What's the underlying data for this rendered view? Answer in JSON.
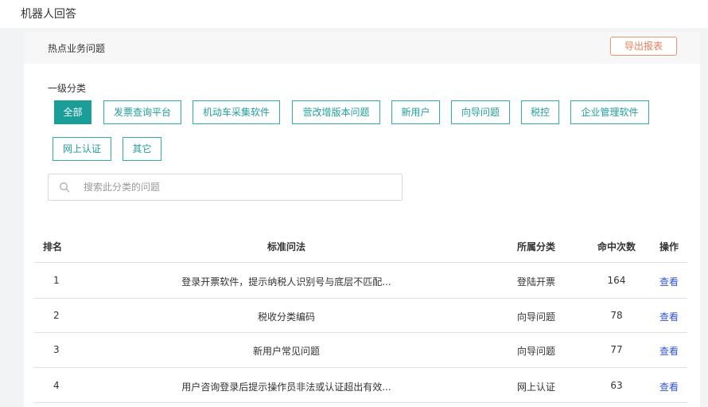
{
  "page": {
    "title": "机器人回答"
  },
  "panel": {
    "title": "热点业务问题",
    "export_label": "导出报表",
    "category_label": "一级分类",
    "categories": [
      {
        "label": "全部",
        "active": true
      },
      {
        "label": "发票查询平台",
        "active": false
      },
      {
        "label": "机动车采集软件",
        "active": false
      },
      {
        "label": "营改增版本问题",
        "active": false
      },
      {
        "label": "新用户",
        "active": false
      },
      {
        "label": "向导问题",
        "active": false
      },
      {
        "label": "税控",
        "active": false
      },
      {
        "label": "企业管理软件",
        "active": false
      },
      {
        "label": "网上认证",
        "active": false
      },
      {
        "label": "其它",
        "active": false
      }
    ],
    "search": {
      "placeholder": "搜索此分类的问题",
      "value": "",
      "icon": "search-icon"
    }
  },
  "table": {
    "headers": {
      "rank": "排名",
      "question": "标准问法",
      "category": "所属分类",
      "hits": "命中次数",
      "action": "操作"
    },
    "rows": [
      {
        "rank": "1",
        "question": "登录开票软件，提示纳税人识别号与底层不匹配...",
        "category": "登陆开票",
        "hits": "164",
        "action": "查看"
      },
      {
        "rank": "2",
        "question": "税收分类编码",
        "category": "向导问题",
        "hits": "78",
        "action": "查看"
      },
      {
        "rank": "3",
        "question": "新用户常见问题",
        "category": "向导问题",
        "hits": "77",
        "action": "查看"
      },
      {
        "rank": "4",
        "question": "用户咨询登录后提示操作员非法或认证超出有效...",
        "category": "网上认证",
        "hits": "63",
        "action": "查看"
      }
    ]
  },
  "colors": {
    "accent": "#1a9e9a",
    "export": "#f07d52",
    "link": "#2f54eb"
  }
}
